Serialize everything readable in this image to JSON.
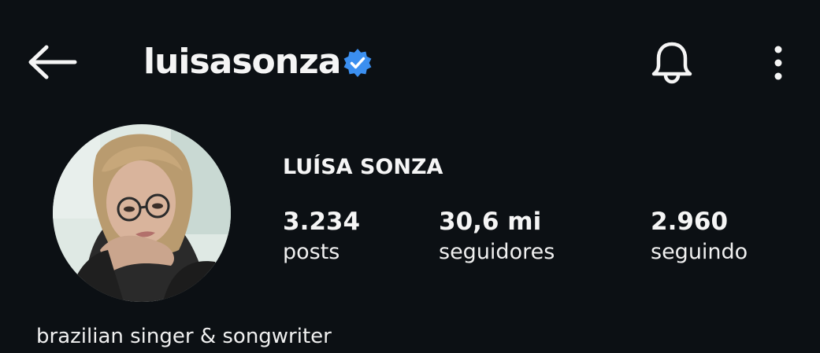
{
  "header": {
    "username": "luisasonza",
    "icons": {
      "back": "arrow-left-icon",
      "verified": "verified-badge-icon",
      "notifications": "bell-icon",
      "more": "more-vertical-icon"
    }
  },
  "profile": {
    "display_name": "LUÍSA SONZA",
    "bio": "brazilian singer & songwriter",
    "avatar": "profile-photo"
  },
  "stats": {
    "posts": {
      "value": "3.234",
      "label": "posts"
    },
    "followers": {
      "value": "30,6 mi",
      "label": "seguidores"
    },
    "following": {
      "value": "2.960",
      "label": "seguindo"
    }
  },
  "colors": {
    "background": "#0c1014",
    "text": "#f5f5f5",
    "verified": "#3b8ff0"
  }
}
